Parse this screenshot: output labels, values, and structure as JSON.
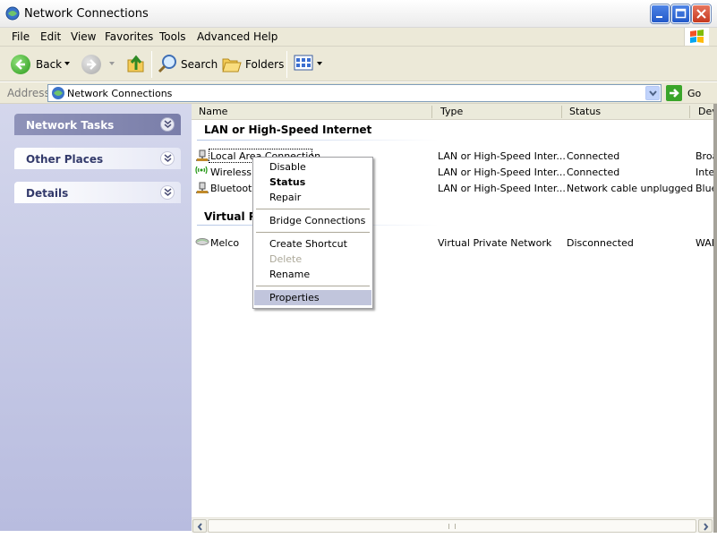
{
  "window": {
    "title": "Network Connections",
    "controls": [
      "minimize",
      "maximize",
      "close"
    ]
  },
  "menu": {
    "items": [
      "File",
      "Edit",
      "View",
      "Favorites",
      "Tools",
      "Advanced",
      "Help"
    ]
  },
  "toolbar": {
    "back_label": "Back",
    "search_label": "Search",
    "folders_label": "Folders"
  },
  "address": {
    "label": "Address",
    "value": "Network Connections",
    "go_label": "Go"
  },
  "taskpane": {
    "panels": [
      {
        "label": "Network Tasks",
        "active": true
      },
      {
        "label": "Other Places",
        "active": false
      },
      {
        "label": "Details",
        "active": false
      }
    ]
  },
  "columns": {
    "name": "Name",
    "type": "Type",
    "status": "Status",
    "device": "Dev"
  },
  "groups": [
    {
      "title": "LAN or High-Speed Internet",
      "rows": [
        {
          "name": "Local Area Connection",
          "type": "LAN or High-Speed Inter...",
          "status": "Connected",
          "device": "Broa",
          "icon": "lan-icon"
        },
        {
          "name": "Wireless N",
          "type": "LAN or High-Speed Inter...",
          "status": "Connected",
          "device": "Inte",
          "icon": "wireless-icon"
        },
        {
          "name": "Bluetooth",
          "type": "LAN or High-Speed Inter...",
          "status": "Network cable unplugged",
          "device": "Blue",
          "icon": "lan-icon"
        }
      ]
    },
    {
      "title": "Virtual Pr",
      "rows": [
        {
          "name": "Melco",
          "type": "Virtual Private Network",
          "status": "Disconnected",
          "device": "WAI",
          "icon": "vpn-icon"
        }
      ]
    }
  ],
  "context_menu": {
    "items": [
      {
        "label": "Disable",
        "bold": false,
        "disabled": false
      },
      {
        "label": "Status",
        "bold": true,
        "disabled": false
      },
      {
        "label": "Repair",
        "bold": false,
        "disabled": false
      },
      {
        "label": "Bridge Connections",
        "bold": false,
        "disabled": false
      },
      {
        "label": "Create Shortcut",
        "bold": false,
        "disabled": false
      },
      {
        "label": "Delete",
        "bold": false,
        "disabled": true
      },
      {
        "label": "Rename",
        "bold": false,
        "disabled": false
      },
      {
        "label": "Properties",
        "bold": false,
        "disabled": false,
        "highlighted": true
      }
    ]
  },
  "colors": {
    "accent": "#c1c5dc",
    "active_panel": "#8f93b9",
    "disabled_text": "#aca899"
  }
}
